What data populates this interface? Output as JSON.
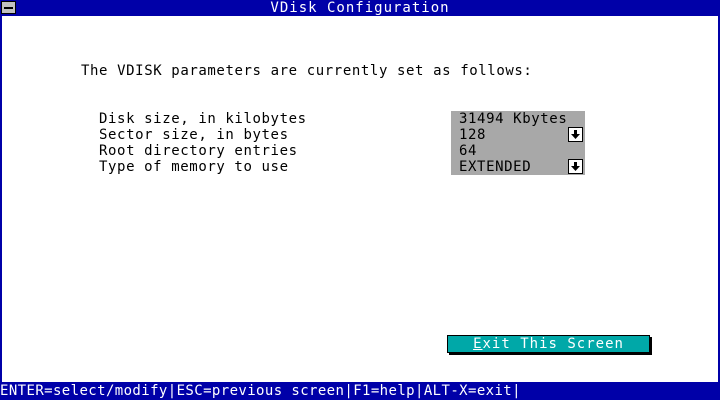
{
  "window": {
    "title": "VDisk Configuration"
  },
  "intro_text": "The VDISK parameters are currently set as follows:",
  "parameters": [
    {
      "label": "Disk size, in kilobytes",
      "value": "31494 Kbytes",
      "has_dropdown": false
    },
    {
      "label": "Sector size, in bytes",
      "value": "128",
      "has_dropdown": true
    },
    {
      "label": "Root directory entries",
      "value": "64",
      "has_dropdown": false
    },
    {
      "label": "Type of memory to use",
      "value": "EXTENDED",
      "has_dropdown": true
    }
  ],
  "exit_button": {
    "hotkey": "E",
    "rest": "xit This Screen"
  },
  "statusbar": {
    "items": [
      "ENTER=select/modify",
      "ESC=previous screen",
      "F1=help",
      "ALT-X=exit"
    ]
  },
  "icons": {
    "system_menu": "system-menu-icon",
    "dropdown": "down-arrow-icon"
  },
  "colors": {
    "title_bg": "#0000a8",
    "value_bg": "#a8a8a8",
    "button_bg": "#00a8a8"
  }
}
